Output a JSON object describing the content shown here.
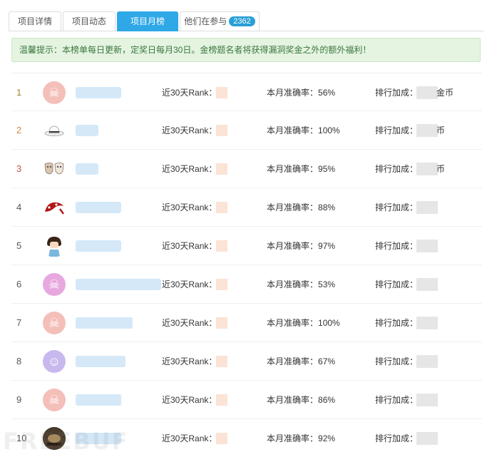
{
  "tabs": [
    {
      "label": "项目详情"
    },
    {
      "label": "项目动态"
    },
    {
      "label": "项目月榜"
    },
    {
      "label": "他们在参与",
      "badge": "2362"
    }
  ],
  "notice": "温馨提示：本榜单每日更新，定奖日每月30日。金榜题名者将获得漏洞奖金之外的额外福利！",
  "labels": {
    "rank30": "近30天Rank：",
    "accuracy": "本月准确率：",
    "bonus": "排行加成："
  },
  "rows": [
    {
      "rank": "1",
      "accuracy": "56%",
      "bonus_unit": "金币"
    },
    {
      "rank": "2",
      "accuracy": "100%",
      "bonus_unit": "币"
    },
    {
      "rank": "3",
      "accuracy": "95%",
      "bonus_unit": "币"
    },
    {
      "rank": "4",
      "accuracy": "88%",
      "bonus_unit": ""
    },
    {
      "rank": "5",
      "accuracy": "97%",
      "bonus_unit": ""
    },
    {
      "rank": "6",
      "accuracy": "53%",
      "bonus_unit": ""
    },
    {
      "rank": "7",
      "accuracy": "100%",
      "bonus_unit": ""
    },
    {
      "rank": "8",
      "accuracy": "67%",
      "bonus_unit": ""
    },
    {
      "rank": "9",
      "accuracy": "86%",
      "bonus_unit": ""
    },
    {
      "rank": "10",
      "accuracy": "92%",
      "bonus_unit": ""
    }
  ],
  "watermark": "FREEBUF",
  "colors": {
    "active_tab": "#2ea8e6",
    "badge": "#2a9fd6",
    "notice_bg": "#e4f4e1",
    "notice_text": "#3c763d",
    "rank_gold": "#a7892b",
    "rank_silver": "#d08a3e",
    "rank_bronze": "#c9544a"
  }
}
